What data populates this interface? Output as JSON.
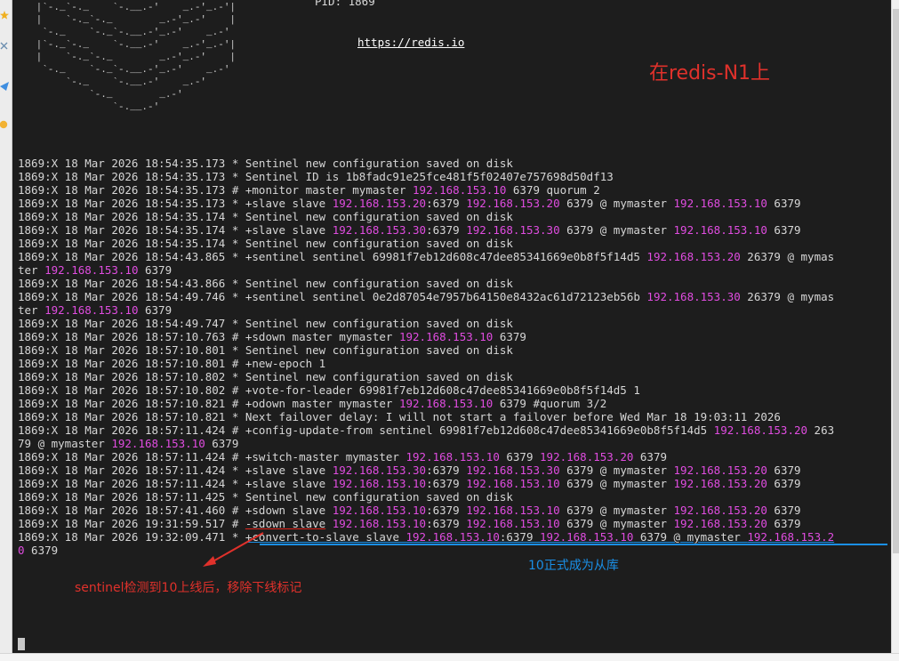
{
  "header": {
    "pid_line": "PID: 1869",
    "url": "https://redis.io",
    "ascii_logo": "      `-._    `-._  `-./  _.-'    _.-'      \n |`-._`-._    `-.__.-'    _.-'_.-'|\n |    `-._`-._        _.-'_.-'    |\n  `-._    `-._`-.__.-'_.-'    _.-'\n |`-._`-._    `-.__.-'    _.-'_.-'|\n |    `-._`-._        _.-'_.-'    |\n  `-._    `-._`-.__.-'_.-'    _.-'\n      `-._    `-.__.-'    _.-'\n          `-._        _.-'\n              `-.__.-'"
  },
  "log": [
    [
      [
        "1869:X 18 Mar 2026 18:54:35.173 * Sentinel new configuration saved on disk",
        0
      ]
    ],
    [
      [
        "1869:X 18 Mar 2026 18:54:35.173 * Sentinel ID is 1b8fadc91e25fce481f5f02407e757698d50df13",
        0
      ]
    ],
    [
      [
        "1869:X 18 Mar 2026 18:54:35.173 # +monitor master mymaster ",
        0
      ],
      [
        "192.168.153.10",
        1
      ],
      [
        " 6379 quorum 2",
        0
      ]
    ],
    [
      [
        "1869:X 18 Mar 2026 18:54:35.173 * +slave slave ",
        0
      ],
      [
        "192.168.153.20",
        1
      ],
      [
        ":6379 ",
        0
      ],
      [
        "192.168.153.20",
        1
      ],
      [
        " 6379 @ mymaster ",
        0
      ],
      [
        "192.168.153.10",
        1
      ],
      [
        " 6379",
        0
      ]
    ],
    [
      [
        "1869:X 18 Mar 2026 18:54:35.174 * Sentinel new configuration saved on disk",
        0
      ]
    ],
    [
      [
        "1869:X 18 Mar 2026 18:54:35.174 * +slave slave ",
        0
      ],
      [
        "192.168.153.30",
        1
      ],
      [
        ":6379 ",
        0
      ],
      [
        "192.168.153.30",
        1
      ],
      [
        " 6379 @ mymaster ",
        0
      ],
      [
        "192.168.153.10",
        1
      ],
      [
        " 6379",
        0
      ]
    ],
    [
      [
        "1869:X 18 Mar 2026 18:54:35.174 * Sentinel new configuration saved on disk",
        0
      ]
    ],
    [
      [
        "1869:X 18 Mar 2026 18:54:43.865 * +sentinel sentinel 69981f7eb12d608c47dee85341669e0b8f5f14d5 ",
        0
      ],
      [
        "192.168.153.20",
        1
      ],
      [
        " 26379 @ mymas",
        0
      ]
    ],
    [
      [
        "ter ",
        0
      ],
      [
        "192.168.153.10",
        1
      ],
      [
        " 6379",
        0
      ]
    ],
    [
      [
        "1869:X 18 Mar 2026 18:54:43.866 * Sentinel new configuration saved on disk",
        0
      ]
    ],
    [
      [
        "1869:X 18 Mar 2026 18:54:49.746 * +sentinel sentinel 0e2d87054e7957b64150e8432ac61d72123eb56b ",
        0
      ],
      [
        "192.168.153.30",
        1
      ],
      [
        " 26379 @ mymas",
        0
      ]
    ],
    [
      [
        "ter ",
        0
      ],
      [
        "192.168.153.10",
        1
      ],
      [
        " 6379",
        0
      ]
    ],
    [
      [
        "1869:X 18 Mar 2026 18:54:49.747 * Sentinel new configuration saved on disk",
        0
      ]
    ],
    [
      [
        "1869:X 18 Mar 2026 18:57:10.763 # +sdown master mymaster ",
        0
      ],
      [
        "192.168.153.10",
        1
      ],
      [
        " 6379",
        0
      ]
    ],
    [
      [
        "1869:X 18 Mar 2026 18:57:10.801 * Sentinel new configuration saved on disk",
        0
      ]
    ],
    [
      [
        "1869:X 18 Mar 2026 18:57:10.801 # +new-epoch 1",
        0
      ]
    ],
    [
      [
        "1869:X 18 Mar 2026 18:57:10.802 * Sentinel new configuration saved on disk",
        0
      ]
    ],
    [
      [
        "1869:X 18 Mar 2026 18:57:10.802 # +vote-for-leader 69981f7eb12d608c47dee85341669e0b8f5f14d5 1",
        0
      ]
    ],
    [
      [
        "1869:X 18 Mar 2026 18:57:10.821 # +odown master mymaster ",
        0
      ],
      [
        "192.168.153.10",
        1
      ],
      [
        " 6379 #quorum 3/2",
        0
      ]
    ],
    [
      [
        "1869:X 18 Mar 2026 18:57:10.821 * Next failover delay: I will not start a failover before Wed Mar 18 19:03:11 2026",
        0
      ]
    ],
    [
      [
        "1869:X 18 Mar 2026 18:57:11.424 # +config-update-from sentinel 69981f7eb12d608c47dee85341669e0b8f5f14d5 ",
        0
      ],
      [
        "192.168.153.20",
        1
      ],
      [
        " 263",
        0
      ]
    ],
    [
      [
        "79 @ mymaster ",
        0
      ],
      [
        "192.168.153.10",
        1
      ],
      [
        " 6379",
        0
      ]
    ],
    [
      [
        "1869:X 18 Mar 2026 18:57:11.424 # +switch-master mymaster ",
        0
      ],
      [
        "192.168.153.10",
        1
      ],
      [
        " 6379 ",
        0
      ],
      [
        "192.168.153.20",
        1
      ],
      [
        " 6379",
        0
      ]
    ],
    [
      [
        "1869:X 18 Mar 2026 18:57:11.424 * +slave slave ",
        0
      ],
      [
        "192.168.153.30",
        1
      ],
      [
        ":6379 ",
        0
      ],
      [
        "192.168.153.30",
        1
      ],
      [
        " 6379 @ mymaster ",
        0
      ],
      [
        "192.168.153.20",
        1
      ],
      [
        " 6379",
        0
      ]
    ],
    [
      [
        "1869:X 18 Mar 2026 18:57:11.424 * +slave slave ",
        0
      ],
      [
        "192.168.153.10",
        1
      ],
      [
        ":6379 ",
        0
      ],
      [
        "192.168.153.10",
        1
      ],
      [
        " 6379 @ mymaster ",
        0
      ],
      [
        "192.168.153.20",
        1
      ],
      [
        " 6379",
        0
      ]
    ],
    [
      [
        "1869:X 18 Mar 2026 18:57:11.425 * Sentinel new configuration saved on disk",
        0
      ]
    ],
    [
      [
        "1869:X 18 Mar 2026 18:57:41.460 # +sdown slave ",
        0
      ],
      [
        "192.168.153.10",
        1
      ],
      [
        ":6379 ",
        0
      ],
      [
        "192.168.153.10",
        1
      ],
      [
        " 6379 @ mymaster ",
        0
      ],
      [
        "192.168.153.20",
        1
      ],
      [
        " 6379",
        0
      ]
    ],
    [
      [
        "1869:X 18 Mar 2026 19:31:59.517 # ",
        0
      ],
      [
        "-sdown slave",
        2
      ],
      [
        " ",
        0
      ],
      [
        "192.168.153.10",
        1
      ],
      [
        ":6379 ",
        0
      ],
      [
        "192.168.153.10",
        1
      ],
      [
        " 6379 @ mymaster ",
        0
      ],
      [
        "192.168.153.20",
        1
      ],
      [
        " 6379",
        0
      ]
    ],
    [
      [
        "1869:X 18 Mar 2026 19:32:09.471 * ",
        0
      ],
      [
        "+convert-to-slave slave ",
        3
      ],
      [
        "192.168.153.10",
        4
      ],
      [
        ":6379 ",
        3
      ],
      [
        "192.168.153.10",
        4
      ],
      [
        " 6379 @ mymaster ",
        3
      ],
      [
        "192.168.153.2",
        4
      ]
    ],
    [
      [
        "0",
        1
      ],
      [
        " 6379",
        0
      ]
    ]
  ],
  "annotations": {
    "title": "在redis-N1上",
    "red_note": "sentinel检测到10上线后，移除下线标记",
    "blue_note": "10正式成为从库"
  },
  "colors": {
    "terminal_bg": "#1d1d1d",
    "terminal_text": "#d6d6d6",
    "ip_highlight": "#e04ce0",
    "annotation_red": "#e0312b",
    "annotation_blue": "#1a8fe6"
  }
}
